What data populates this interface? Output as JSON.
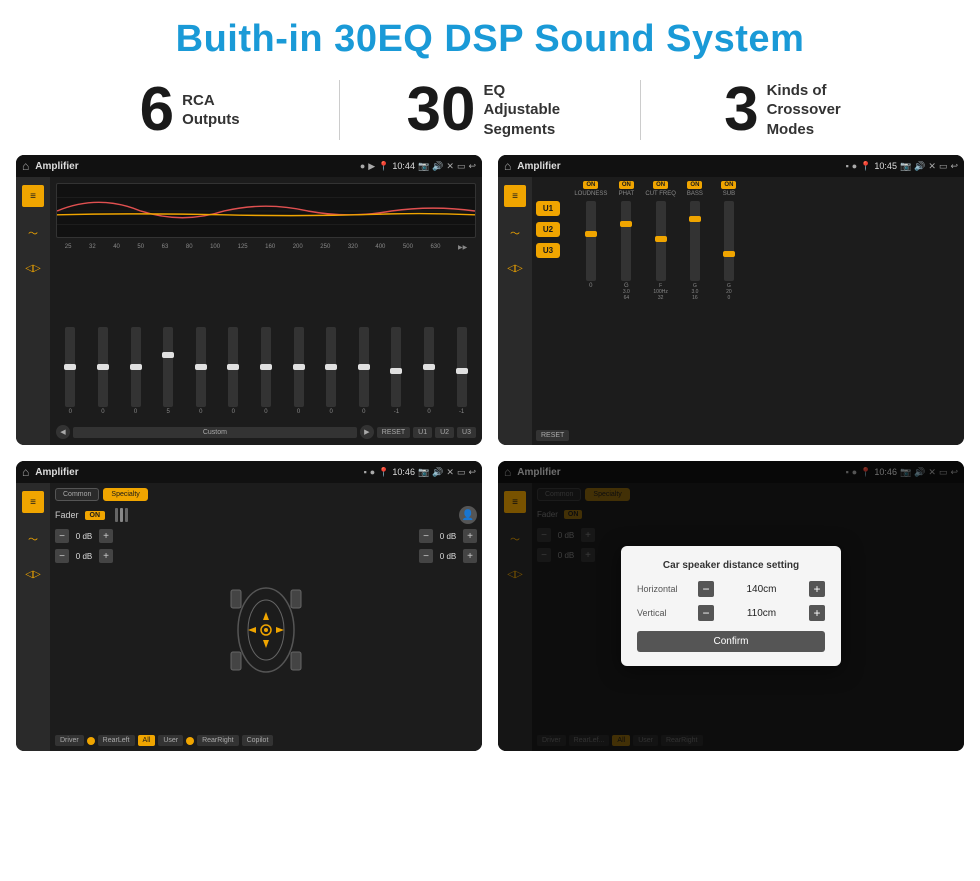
{
  "page": {
    "title": "Buith-in 30EQ DSP Sound System"
  },
  "stats": [
    {
      "number": "6",
      "label": "RCA\nOutputs"
    },
    {
      "number": "30",
      "label": "EQ Adjustable\nSegments"
    },
    {
      "number": "3",
      "label": "Kinds of\nCrossover Modes"
    }
  ],
  "screens": [
    {
      "id": "eq-screen",
      "title": "Amplifier",
      "time": "10:44",
      "type": "equalizer"
    },
    {
      "id": "crossover-screen",
      "title": "Amplifier",
      "time": "10:45",
      "type": "crossover"
    },
    {
      "id": "fader-screen",
      "title": "Amplifier",
      "time": "10:46",
      "type": "fader"
    },
    {
      "id": "dialog-screen",
      "title": "Amplifier",
      "time": "10:46",
      "type": "dialog"
    }
  ],
  "eq": {
    "frequencies": [
      "25",
      "32",
      "40",
      "50",
      "63",
      "80",
      "100",
      "125",
      "160",
      "200",
      "250",
      "320",
      "400",
      "500",
      "630"
    ],
    "values": [
      "0",
      "0",
      "0",
      "5",
      "0",
      "0",
      "0",
      "0",
      "0",
      "0",
      "-1",
      "0",
      "-1"
    ],
    "presets": [
      "Custom",
      "RESET",
      "U1",
      "U2",
      "U3"
    ]
  },
  "crossover": {
    "channels": [
      "U1",
      "U2",
      "U3"
    ],
    "controls": [
      {
        "label": "LOUDNESS",
        "on": true
      },
      {
        "label": "PHAT",
        "on": true
      },
      {
        "label": "CUT FREQ",
        "on": true
      },
      {
        "label": "BASS",
        "on": true
      },
      {
        "label": "SUB",
        "on": true
      }
    ]
  },
  "fader": {
    "tabs": [
      "Common",
      "Specialty"
    ],
    "faderLabel": "Fader",
    "positions": [
      "Driver",
      "RearLeft",
      "All",
      "User",
      "RearRight",
      "Copilot"
    ],
    "dbValues": [
      "0 dB",
      "0 dB",
      "0 dB",
      "0 dB"
    ]
  },
  "dialog": {
    "title": "Car speaker distance setting",
    "horizontalLabel": "Horizontal",
    "horizontalValue": "140cm",
    "verticalLabel": "Vertical",
    "verticalValue": "110cm",
    "confirmLabel": "Confirm"
  }
}
